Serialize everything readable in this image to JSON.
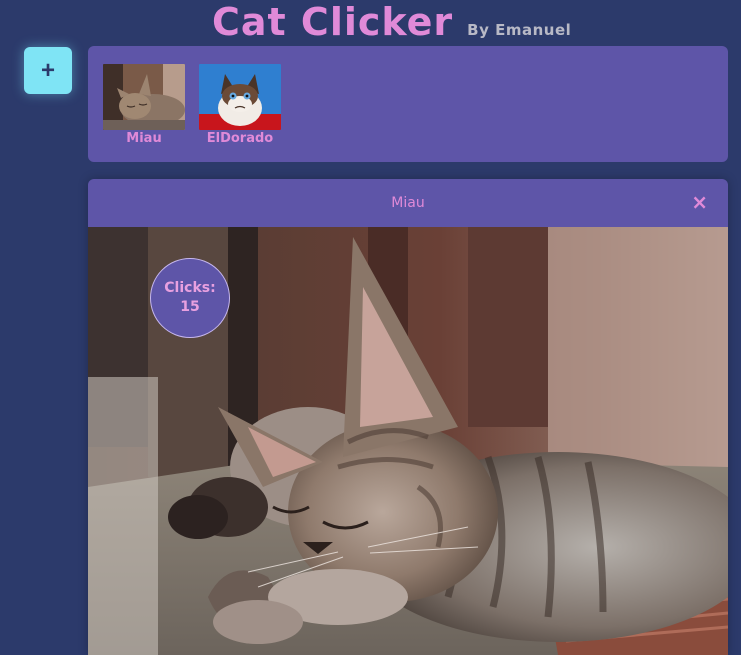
{
  "header": {
    "title": "Cat Clicker",
    "byline": "By Emanuel"
  },
  "add_button": {
    "label": "+"
  },
  "gallery": {
    "items": [
      {
        "name": "Miau",
        "icon": "sleeping-kitten-thumbnail"
      },
      {
        "name": "ElDorado",
        "icon": "grumpy-cat-thumbnail"
      }
    ]
  },
  "viewer": {
    "title": "Miau",
    "close_label": "×",
    "clicks_label": "Clicks:",
    "clicks_count": "15",
    "image": "sleeping-kitten-photo"
  },
  "colors": {
    "background": "#2c3a6b",
    "panel": "#5e55a8",
    "accent_pink": "#e08ad8",
    "add_button": "#7fe4f5"
  }
}
